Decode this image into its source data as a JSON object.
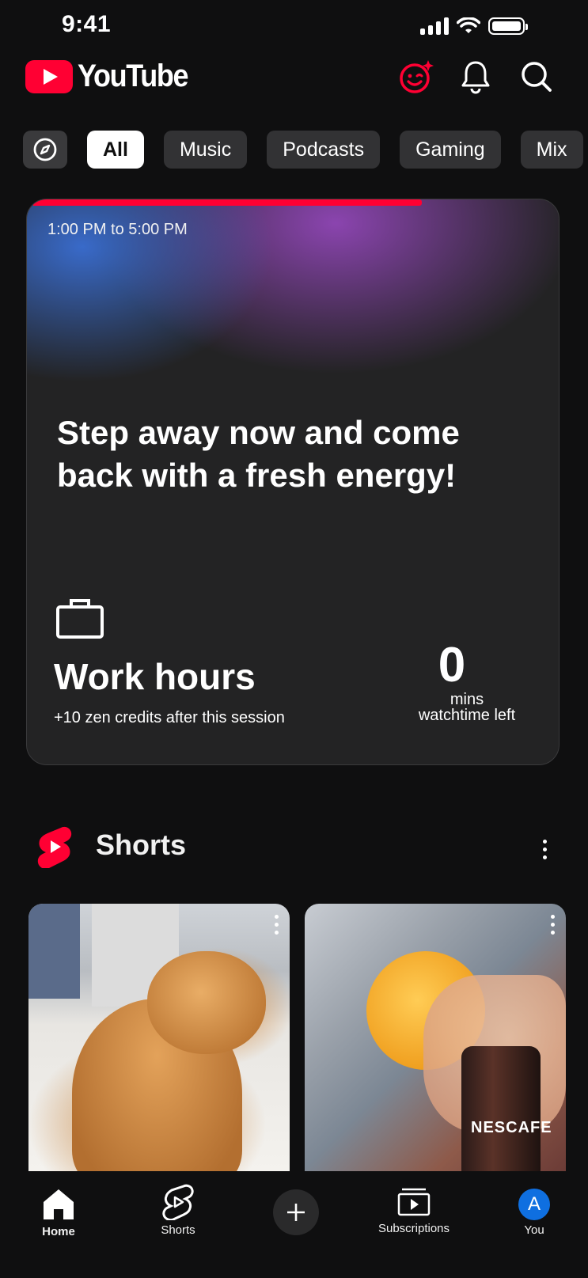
{
  "status_bar": {
    "time": "9:41"
  },
  "header": {
    "logo_text": "YouTube"
  },
  "chips": [
    "All",
    "Music",
    "Podcasts",
    "Gaming",
    "Mix"
  ],
  "zen_card": {
    "time_range": "1:00 PM to 5:00 PM",
    "message": "Step away now and come back with a fresh energy!",
    "mode_title": "Work hours",
    "mode_subtitle": "+10 zen credits after this session",
    "mins_value": "0",
    "mins_unit": "mins",
    "mins_caption": "watchtime left",
    "progress_fraction": 0.73
  },
  "shorts_section": {
    "title": "Shorts",
    "items": [
      {
        "thumbnail": "cat-on-bed"
      },
      {
        "thumbnail": "ice-cream-and-coffee",
        "visible_label": "NESCAFE"
      }
    ]
  },
  "bottom_nav": {
    "home": "Home",
    "shorts": "Shorts",
    "subscriptions": "Subscriptions",
    "you": "You",
    "avatar_letter": "A"
  },
  "colors": {
    "brand_red": "#ff0033",
    "background": "#0f0f10",
    "chip_bg": "#323234",
    "avatar_blue": "#0f6fe0"
  },
  "icons": {
    "explore": "compass-icon",
    "zen": "smiley-sparkle-icon",
    "notifications": "bell-icon",
    "search": "search-icon",
    "work": "briefcase-icon",
    "more": "kebab-menu-icon"
  }
}
